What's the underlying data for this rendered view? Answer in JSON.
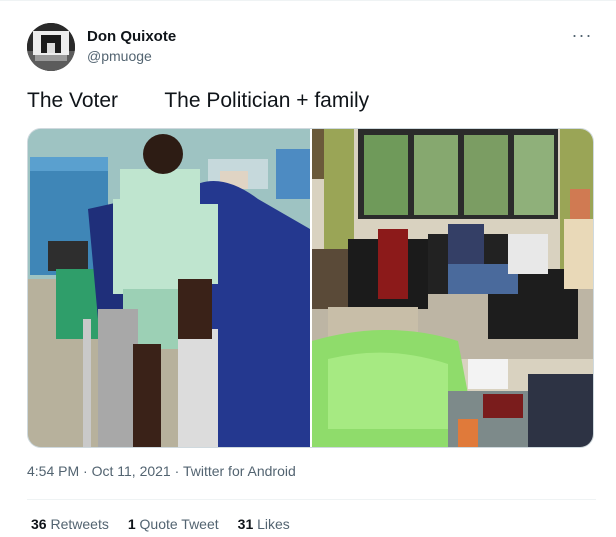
{
  "author": {
    "name": "Don Quixote",
    "handle": "@pmuoge"
  },
  "more_label": "···",
  "tweet": {
    "text": "The Voter        The Politician + family"
  },
  "meta": {
    "time": "4:54 PM",
    "date": "Oct 11, 2021",
    "source": "Twitter for Android",
    "separator": "·"
  },
  "stats": {
    "retweets": {
      "count": "36",
      "label": "Retweets"
    },
    "quotes": {
      "count": "1",
      "label": "Quote Tweet"
    },
    "likes": {
      "count": "31",
      "label": "Likes"
    }
  },
  "icons": [
    "more-options-icon"
  ],
  "colors": {
    "text": "#0f1419",
    "secondary": "#536471",
    "border": "#eff3f4"
  }
}
